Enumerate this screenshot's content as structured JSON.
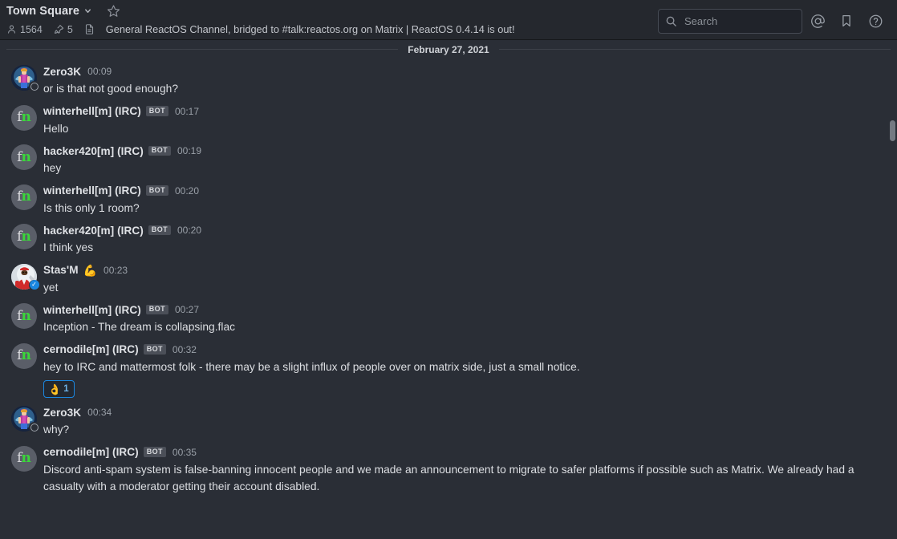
{
  "header": {
    "channel_name": "Town Square",
    "chevron": "⌵",
    "favorite_icon": "star-icon",
    "member_count": "1564",
    "pinned_count": "5",
    "files_icon": "file-icon",
    "channel_purpose": "General ReactOS Channel, bridged to #talk:reactos.org on Matrix | ReactOS 0.4.14 is out!",
    "search": {
      "placeholder": "Search",
      "value": "",
      "icon": "search-icon"
    },
    "mentions_icon": "at-mention-icon",
    "saved_icon": "bookmark-flag-icon",
    "help_icon": "help-question-icon"
  },
  "colors": {
    "background": "#2a2e36",
    "header_background": "#25282e",
    "accent": "#1b87e0",
    "text": "#dcdee2",
    "muted_text": "#9aa0a8",
    "bot_tag_bg": "#4b4f58",
    "avatar_n_green": "#3ad63a"
  },
  "date_separator": "February 27, 2021",
  "messages": [
    {
      "username": "Zero3K",
      "avatar_type": "art-zero3k",
      "status": "offline",
      "is_bot": false,
      "user_emoji": "",
      "time": "00:09",
      "text": "or is that not good enough?",
      "reactions": []
    },
    {
      "username": "winterhell[m] (IRC)",
      "avatar_type": "fn",
      "status": "none",
      "is_bot": true,
      "bot_label": "BOT",
      "user_emoji": "",
      "time": "00:17",
      "text": "Hello",
      "reactions": []
    },
    {
      "username": "hacker420[m] (IRC)",
      "avatar_type": "fn",
      "status": "none",
      "is_bot": true,
      "bot_label": "BOT",
      "user_emoji": "",
      "time": "00:19",
      "text": "hey",
      "reactions": []
    },
    {
      "username": "winterhell[m] (IRC)",
      "avatar_type": "fn",
      "status": "none",
      "is_bot": true,
      "bot_label": "BOT",
      "user_emoji": "",
      "time": "00:20",
      "text": "Is this only 1 room?",
      "reactions": []
    },
    {
      "username": "hacker420[m] (IRC)",
      "avatar_type": "fn",
      "status": "none",
      "is_bot": true,
      "bot_label": "BOT",
      "user_emoji": "",
      "time": "00:20",
      "text": "I think yes",
      "reactions": []
    },
    {
      "username": "Stas'M",
      "avatar_type": "art-stasm",
      "status": "verified",
      "is_bot": false,
      "user_emoji": "💪",
      "time": "00:23",
      "text": "yet",
      "reactions": []
    },
    {
      "username": "winterhell[m] (IRC)",
      "avatar_type": "fn",
      "status": "none",
      "is_bot": true,
      "bot_label": "BOT",
      "user_emoji": "",
      "time": "00:27",
      "text": "Inception - The dream is collapsing.flac",
      "reactions": []
    },
    {
      "username": "cernodile[m] (IRC)",
      "avatar_type": "fn",
      "status": "none",
      "is_bot": true,
      "bot_label": "BOT",
      "user_emoji": "",
      "time": "00:32",
      "text": "hey to IRC and mattermost folk - there may be a slight influx of people over on matrix side, just a small notice.",
      "reactions": [
        {
          "emoji": "👌",
          "name": "ok-hand-emoji",
          "count": "1"
        }
      ]
    },
    {
      "username": "Zero3K",
      "avatar_type": "art-zero3k",
      "status": "offline",
      "is_bot": false,
      "user_emoji": "",
      "time": "00:34",
      "text": "why?",
      "reactions": []
    },
    {
      "username": "cernodile[m] (IRC)",
      "avatar_type": "fn",
      "status": "none",
      "is_bot": true,
      "bot_label": "BOT",
      "user_emoji": "",
      "time": "00:35",
      "text": "Discord anti-spam system is false-banning innocent people and we made an announcement to migrate to safer platforms if possible such as Matrix. We already had a casualty with a moderator getting their account disabled.",
      "reactions": []
    }
  ]
}
